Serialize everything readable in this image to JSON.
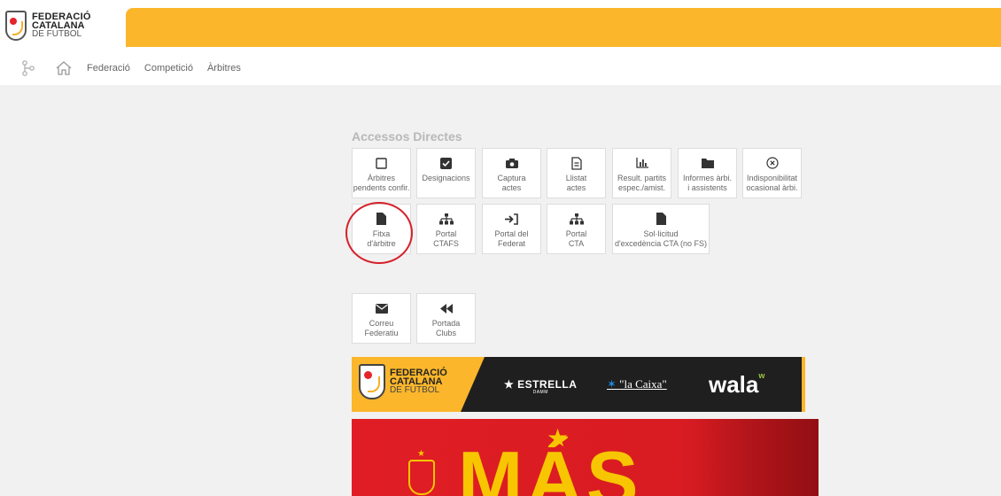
{
  "header": {
    "logo_line1": "FEDERACIÓ",
    "logo_line2": "CATALANA",
    "logo_line3": "DE FUTBOL"
  },
  "nav": {
    "items": [
      "Federació",
      "Competició",
      "Àrbitres"
    ]
  },
  "section": {
    "title": "Accessos Directes"
  },
  "tiles": [
    {
      "label": "Àrbitres\npendents confir.",
      "icon": "checkbox-empty-icon"
    },
    {
      "label": "Designacions",
      "icon": "checkbox-checked-icon"
    },
    {
      "label": "Captura\nactes",
      "icon": "camera-icon"
    },
    {
      "label": "Llistat\nactes",
      "icon": "document-lines-icon"
    },
    {
      "label": "Result. partits\nespec./amist.",
      "icon": "bar-chart-icon"
    },
    {
      "label": "Informes àrbi.\ni assistents",
      "icon": "folder-icon"
    },
    {
      "label": "Indisponibilitat\nocasional àrbi.",
      "icon": "circle-x-icon"
    },
    {
      "label": "Fitxa\nd'àrbitre",
      "icon": "file-icon"
    },
    {
      "label": "Portal\nCTAFS",
      "icon": "sitemap-icon"
    },
    {
      "label": "Portal del\nFederat",
      "icon": "sign-in-icon"
    },
    {
      "label": "Portal\nCTA",
      "icon": "sitemap-icon"
    },
    {
      "label": "Sol·licitud\nd'excedència CTA (no FS)",
      "icon": "file-icon"
    },
    {
      "label": "Correu\nFederatiu",
      "icon": "envelope-icon"
    },
    {
      "label": "Portada\nClubs",
      "icon": "backward-icon"
    }
  ],
  "sponsors": {
    "fcf_line1": "FEDERACIÓ",
    "fcf_line2": "CATALANA",
    "fcf_line3": "DE FUTBOL",
    "estrella": "★ ESTRELLA",
    "estrella_sub": "DAMM",
    "caixa": "\"la Caixa\"",
    "wala": "wala",
    "wala_sup": "w"
  },
  "promo": {
    "text": "MÁS"
  },
  "colors": {
    "brand_yellow": "#fbb62b",
    "highlight_red": "#d6202a",
    "promo_red": "#e01d24",
    "promo_gold": "#f7c600"
  }
}
